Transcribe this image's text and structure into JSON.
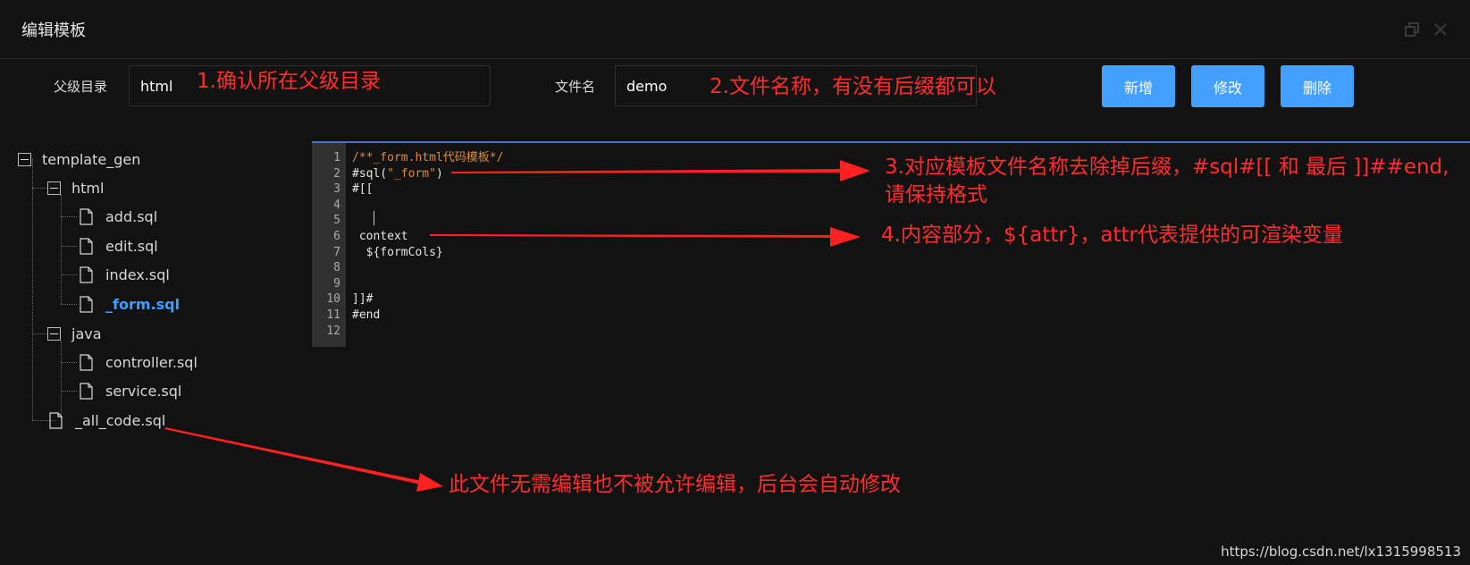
{
  "dialog": {
    "title": "编辑模板"
  },
  "form": {
    "parent_dir_label": "父级目录",
    "parent_dir_value": "html",
    "filename_label": "文件名",
    "filename_value": "demo"
  },
  "buttons": {
    "add": "新增",
    "edit": "修改",
    "delete": "删除"
  },
  "tree": {
    "root": "template_gen",
    "html_folder": "html",
    "html_files": [
      "add.sql",
      "edit.sql",
      "index.sql",
      "_form.sql"
    ],
    "java_folder": "java",
    "java_files": [
      "controller.sql",
      "service.sql"
    ],
    "root_file": "_all_code.sql",
    "selected": "_form.sql"
  },
  "editor": {
    "line_numbers": [
      "1",
      "2",
      "3",
      "4",
      "5",
      "6",
      "7",
      "8",
      "9",
      "10",
      "11",
      "12"
    ],
    "lines": {
      "l1": "/**_form.html代码模板*/",
      "l2_prefix": "#sql(",
      "l2_string": "\"_form\"",
      "l2_suffix": ")",
      "l3": "#[[",
      "l4": "",
      "l5": "",
      "l6": " context",
      "l7": "  ${formCols}",
      "l8": "",
      "l9": "",
      "l10": "]]#",
      "l11": "#end",
      "l12": ""
    }
  },
  "annotations": {
    "a1": "1.确认所在父级目录",
    "a2": "2.文件名称，有没有后缀都可以",
    "a3_line1": "3.对应模板文件名称去除掉后缀，#sql#[[ 和 最后 ]]##end,",
    "a3_line2": "请保持格式",
    "a4": "4.内容部分，${attr}，attr代表提供的可渲染变量",
    "a5": "此文件无需编辑也不被允许编辑，后台会自动修改"
  },
  "colors": {
    "background": "#121212",
    "accent_button": "#43a0ff",
    "annotation_red": "#ff2d2d",
    "selected_node": "#409eff",
    "code_string": "#e08a3c"
  },
  "watermark": "https://blog.csdn.net/lx1315998513"
}
